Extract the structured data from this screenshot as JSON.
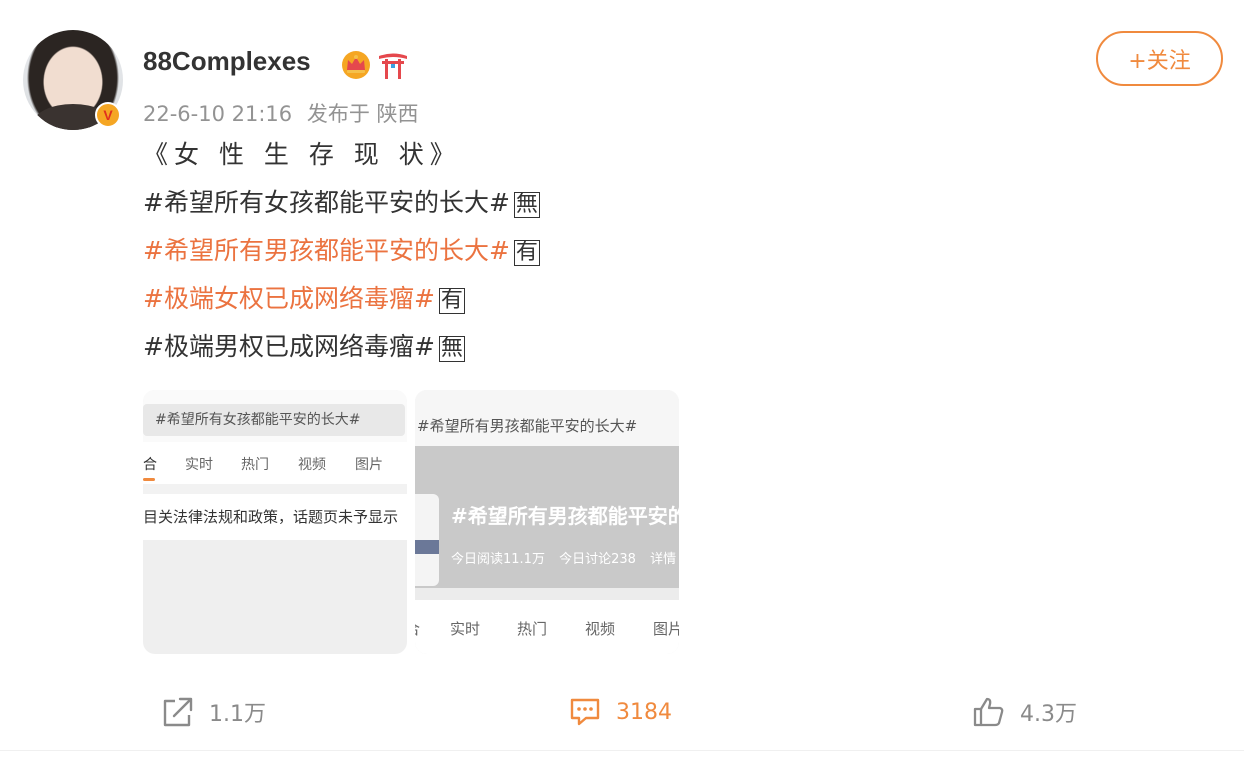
{
  "user": {
    "name": "88Complexes",
    "badge_letter": "V",
    "timestamp": "22-6-10 21:16",
    "source": "发布于 陕西"
  },
  "follow": {
    "label": "+关注"
  },
  "post": {
    "title": "《女 性 生 存 现 状》",
    "lines": [
      {
        "text": "#希望所有女孩都能平安的长大#",
        "mark": "無",
        "style": "plain"
      },
      {
        "text": "#希望所有男孩都能平安的长大#",
        "mark": "有",
        "style": "link"
      },
      {
        "text": "#极端女权已成网络毒瘤#",
        "mark": "有",
        "style": "link"
      },
      {
        "text": "#极端男权已成网络毒瘤#",
        "mark": "無",
        "style": "plain"
      }
    ]
  },
  "images": [
    {
      "search_text": "#希望所有女孩都能平安的长大#",
      "tabs": [
        "合",
        "实时",
        "热门",
        "视频",
        "图片"
      ],
      "notice": "目关法律法规和政策，话题页未予显示"
    },
    {
      "search_text": "#希望所有男孩都能平安的长大#",
      "banner_title": "#希望所有男孩都能平安的长大#",
      "stats": [
        "今日阅读11.1万",
        "今日讨论238",
        "详情"
      ],
      "tabs": [
        "合",
        "实时",
        "热门",
        "视频",
        "图片"
      ]
    }
  ],
  "actions": {
    "share_count": "1.1万",
    "comment_count": "3184",
    "like_count": "4.3万"
  },
  "colors": {
    "accent": "#f08a3e",
    "link": "#eb7340",
    "text": "#333333",
    "muted": "#939393"
  },
  "icons": [
    "share-icon",
    "comment-icon",
    "like-icon",
    "crown-icon",
    "torii-icon"
  ]
}
